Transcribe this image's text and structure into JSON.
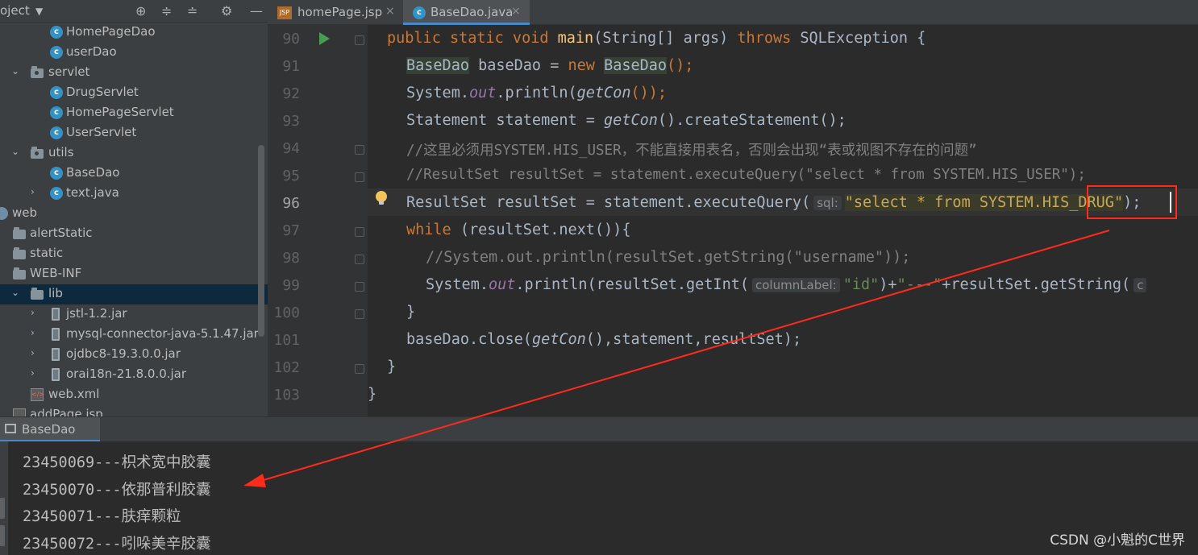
{
  "project_panel": {
    "title": "oject",
    "tree": [
      {
        "label": "HomePageDao",
        "type": "class"
      },
      {
        "label": "userDao",
        "type": "class"
      },
      {
        "label": "servlet",
        "type": "package"
      },
      {
        "label": "DrugServlet",
        "type": "class"
      },
      {
        "label": "HomePageServlet",
        "type": "class"
      },
      {
        "label": "UserServlet",
        "type": "class"
      },
      {
        "label": "utils",
        "type": "package"
      },
      {
        "label": "BaseDao",
        "type": "class"
      },
      {
        "label": "text.java",
        "type": "class"
      },
      {
        "label": "web",
        "type": "web"
      },
      {
        "label": "alertStatic",
        "type": "folder"
      },
      {
        "label": "static",
        "type": "folder"
      },
      {
        "label": "WEB-INF",
        "type": "folder"
      },
      {
        "label": "lib",
        "type": "folder"
      },
      {
        "label": "jstl-1.2.jar",
        "type": "jar"
      },
      {
        "label": "mysql-connector-java-5.1.47.jar",
        "type": "jar"
      },
      {
        "label": "ojdbc8-19.3.0.0.jar",
        "type": "jar"
      },
      {
        "label": "orai18n-21.8.0.0.jar",
        "type": "jar"
      },
      {
        "label": "web.xml",
        "type": "xml"
      },
      {
        "label": "addPage.jsp",
        "type": "jsp"
      }
    ]
  },
  "tabs": [
    {
      "label": "homePage.jsp",
      "icon": "jsp-file-icon",
      "close": "×"
    },
    {
      "label": "BaseDao.java",
      "icon": "java-class-icon",
      "close": "×"
    }
  ],
  "editor": {
    "line_numbers": [
      "90",
      "91",
      "92",
      "93",
      "94",
      "95",
      "96",
      "97",
      "98",
      "99",
      "100",
      "101",
      "102",
      "103"
    ],
    "l90": {
      "a": "public static void ",
      "b": "main",
      "c": "(String[] args) ",
      "d": "throws",
      "e": " SQLException {"
    },
    "l91": {
      "a": "BaseDao",
      "b": " baseDao = ",
      "c": "new ",
      "d": "BaseDao",
      "e": "();"
    },
    "l92": {
      "a": "System.",
      "b": "out",
      "c": ".println(",
      "d": "getCon",
      "e": "());"
    },
    "l93": {
      "a": "Statement statement = ",
      "b": "getCon",
      "c": "().createStatement();"
    },
    "l94": {
      "a": "//这里必须用SYSTEM.HIS_USER，不能直接用表名，否则会出现“表或视图不存在的问题”"
    },
    "l95": {
      "a": "//ResultSet resultSet = statement.executeQuery(\"select * from SYSTEM.HIS_USER\");"
    },
    "l96": {
      "a": "ResultSet resultSet = statement.executeQuery(",
      "hint": "sql:",
      "b": "\"select * from SYSTEM.",
      "c": "HIS_DRUG",
      "d": "\"",
      "e": ");"
    },
    "l97": {
      "a": "while",
      "b": " (resultSet.next()){"
    },
    "l98": {
      "a": "//System.out.println(resultSet.getString(\"username\"));"
    },
    "l99": {
      "a": "System.",
      "b": "out",
      "c": ".println(resultSet.getInt(",
      "hint": "columnLabel:",
      "d": "\"id\"",
      "e": ")+",
      "f": "\"---\"",
      "g": "+resultSet.getString(",
      "hint2": "c"
    },
    "l100": {
      "a": "}"
    },
    "l101": {
      "a": "baseDao.close(",
      "b": "getCon",
      "c": "(),statement,resultSet);"
    },
    "l102": {
      "a": "}"
    },
    "l103": {
      "a": "}"
    }
  },
  "run_panel": {
    "tab_label": "BaseDao",
    "output": [
      "23450069---枳术宽中胶囊",
      "23450070---依那普利胶囊",
      "23450071---肤痒颗粒",
      "23450072---吲哚美辛胶囊"
    ]
  },
  "watermark": "CSDN @小魁的C世界",
  "colors": {
    "annotation_red": "#ff2a1a",
    "keyword": "#cc7832",
    "method": "#ffc66d",
    "string": "#6a8759",
    "comment": "#808080"
  }
}
